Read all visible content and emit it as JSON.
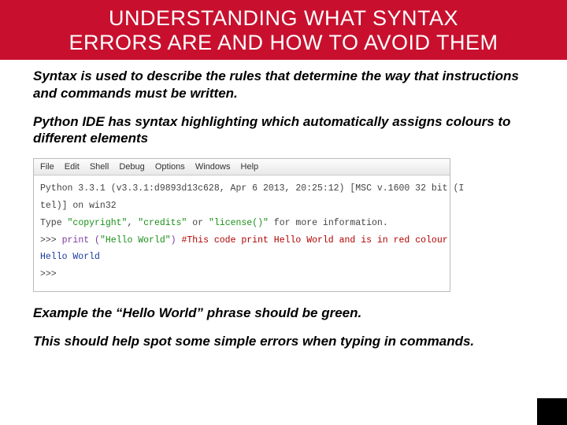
{
  "header": {
    "line1": "UNDERSTANDING  WHAT SYNTAX",
    "line2": "ERRORS ARE AND HOW TO AVOID THEM"
  },
  "paragraphs": {
    "p1": "Syntax is used to describe the rules that determine the way that instructions and commands must be written.",
    "p2": "Python IDE has syntax highlighting which automatically assigns colours to different elements",
    "p3": "Example the “Hello World” phrase should be green.",
    "p4": "This should help spot some simple errors when typing in commands."
  },
  "ide": {
    "menu": {
      "file": "File",
      "edit": "Edit",
      "shell": "Shell",
      "debug": "Debug",
      "options": "Options",
      "windows": "Windows",
      "help": "Help"
    },
    "banner1": "Python 3.3.1 (v3.3.1:d9893d13c628, Apr  6 2013, 20:25:12) [MSC v.1600 32 bit (I",
    "banner2": "tel)] on win32",
    "banner3a": "Type ",
    "banner3b": "\"copyright\"",
    "banner3c": ", ",
    "banner3d": "\"credits\"",
    "banner3e": " or ",
    "banner3f": "\"license()\"",
    "banner3g": " for more information.",
    "line4_prompt": ">>> ",
    "line4_print": "print ",
    "line4_open": "(",
    "line4_str": "\"Hello World\"",
    "line4_close": ") ",
    "line4_comment": "#This code print Hello World and is in red colour",
    "line5": "Hello World",
    "line6": ">>> "
  }
}
